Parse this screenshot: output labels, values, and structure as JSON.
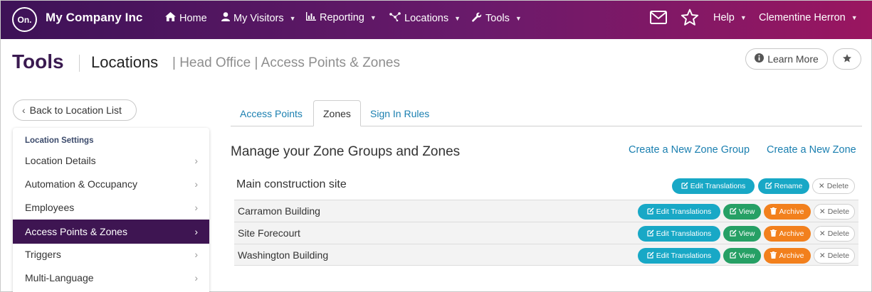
{
  "nav": {
    "logo_text": "On.",
    "company": "My Company Inc",
    "items": [
      {
        "label": "Home"
      },
      {
        "label": "My Visitors"
      },
      {
        "label": "Reporting"
      },
      {
        "label": "Locations"
      },
      {
        "label": "Tools"
      }
    ],
    "help": "Help",
    "user": "Clementine Herron"
  },
  "header": {
    "title": "Tools",
    "breadcrumb_main": "Locations",
    "breadcrumb_sub": "| Head Office | Access Points & Zones",
    "learn_more": "Learn More"
  },
  "sidebar": {
    "back": "Back to Location List",
    "heading": "Location Settings",
    "items": [
      {
        "label": "Location Details"
      },
      {
        "label": "Automation & Occupancy"
      },
      {
        "label": "Employees"
      },
      {
        "label": "Access Points & Zones"
      },
      {
        "label": "Triggers"
      },
      {
        "label": "Multi-Language"
      }
    ],
    "active_item": "Access Points & Zones"
  },
  "tabs": [
    {
      "label": "Access Points"
    },
    {
      "label": "Zones"
    },
    {
      "label": "Sign In Rules"
    }
  ],
  "active_tab": "Zones",
  "main": {
    "title": "Manage your Zone Groups and Zones",
    "create_group": "Create a New Zone Group",
    "create_zone": "Create a New Zone",
    "group": {
      "name": "Main construction site",
      "edit_translations": "Edit Translations",
      "rename": "Rename",
      "delete": "Delete"
    },
    "zones": [
      {
        "name": "Carramon Building"
      },
      {
        "name": "Site Forecourt"
      },
      {
        "name": "Washington Building"
      }
    ],
    "zone_actions": {
      "edit_translations": "Edit Translations",
      "view": "View",
      "archive": "Archive",
      "delete": "Delete"
    }
  },
  "colors": {
    "nav_start": "#3d1257",
    "nav_end": "#9a1660",
    "active_sidebar": "#3e1552",
    "link": "#1a7fb0",
    "teal": "#18a8c6",
    "green": "#26a065",
    "orange": "#f2801d"
  }
}
